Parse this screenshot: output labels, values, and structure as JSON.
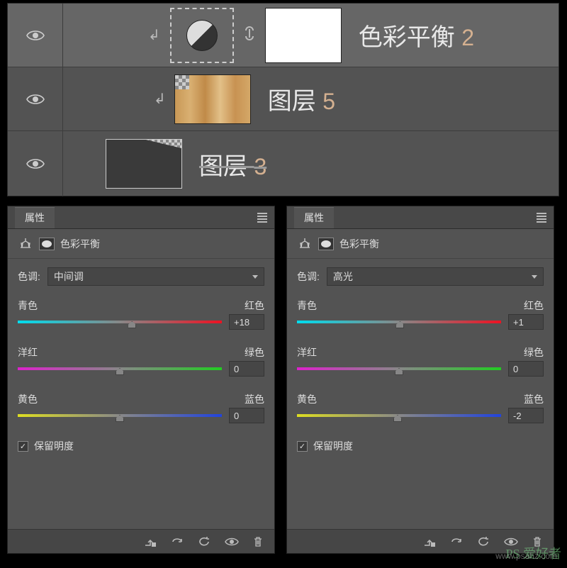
{
  "layers": {
    "row1": {
      "name": "色彩平衡",
      "index": "2"
    },
    "row2": {
      "name": "图层",
      "index": "5"
    },
    "row3": {
      "name": "图层",
      "index": "3"
    }
  },
  "prop_tab": "属性",
  "adjustment_name": "色彩平衡",
  "tone_label": "色调:",
  "midtones": "中间调",
  "highlights": "高光",
  "slider_labels": {
    "cyan": "青色",
    "red": "红色",
    "magenta": "洋红",
    "green": "绿色",
    "yellow": "黄色",
    "blue": "蓝色"
  },
  "left_panel": {
    "cr": "+18",
    "mg": "0",
    "yb": "0"
  },
  "right_panel": {
    "cr": "+1",
    "mg": "0",
    "yb": "-2"
  },
  "preserve": "保留明度",
  "watermark": {
    "brand": "PS 爱好者",
    "url": "www.psahz.com"
  }
}
